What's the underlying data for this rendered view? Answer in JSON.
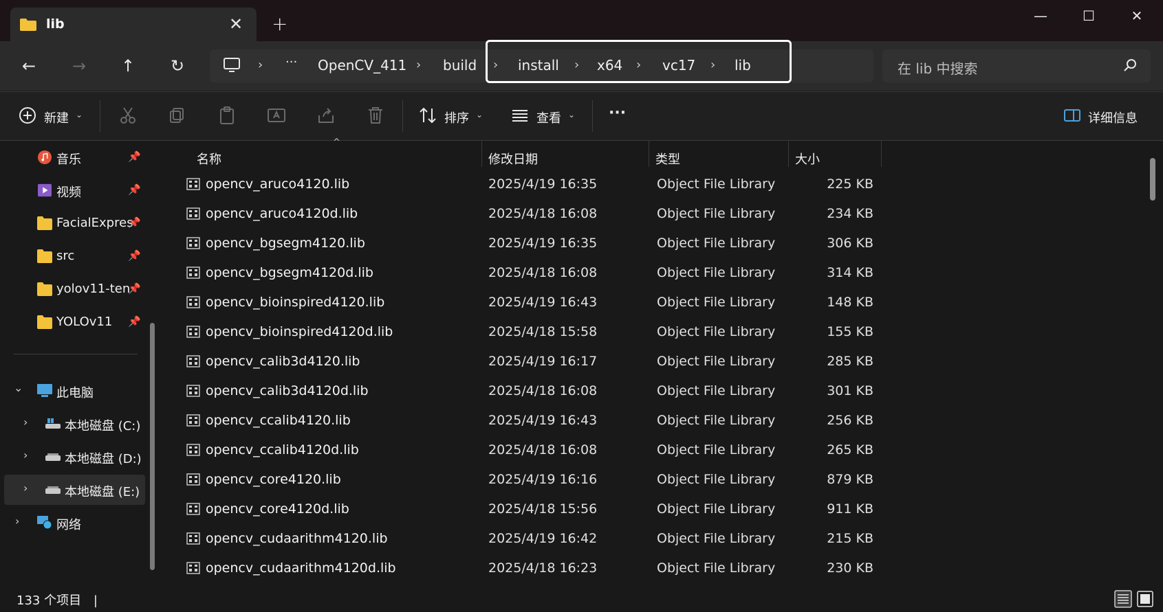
{
  "window": {
    "tab_label": "lib",
    "new_tab_symbol": "+",
    "close_tab_symbol": "✕",
    "minimize_symbol": "—",
    "maximize_symbol": "☐",
    "close_symbol": "✕"
  },
  "nav": {
    "back_symbol": "←",
    "forward_symbol": "→",
    "up_symbol": "↑",
    "refresh_symbol": "↻",
    "more_symbol": "···",
    "breadcrumb": [
      "OpenCV_411",
      "build",
      "install",
      "x64",
      "vc17",
      "lib"
    ],
    "separator": "›",
    "search_placeholder": "在 lib 中搜索"
  },
  "toolbar": {
    "new_label": "新建",
    "sort_label": "排序",
    "view_label": "查看",
    "more_label": "···",
    "details_label": "详细信息"
  },
  "sidebar": {
    "quick_access": [
      {
        "label": "音乐",
        "icon": "music-icon"
      },
      {
        "label": "视频",
        "icon": "video-icon"
      },
      {
        "label": "FacialExpres",
        "icon": "folder-icon"
      },
      {
        "label": "src",
        "icon": "folder-icon"
      },
      {
        "label": "yolov11-ten",
        "icon": "folder-icon"
      },
      {
        "label": "YOLOv11",
        "icon": "folder-icon"
      }
    ],
    "pin_symbol": "📌",
    "this_pc": "此电脑",
    "drives": [
      "本地磁盘 (C:)",
      "本地磁盘 (D:)",
      "本地磁盘 (E:)"
    ],
    "network": "网络"
  },
  "columns": {
    "name": "名称",
    "date": "修改日期",
    "type": "类型",
    "size": "大小"
  },
  "files": [
    {
      "name": "opencv_aruco4120.lib",
      "date": "2025/4/19 16:35",
      "type": "Object File Library",
      "size": "225 KB"
    },
    {
      "name": "opencv_aruco4120d.lib",
      "date": "2025/4/18 16:08",
      "type": "Object File Library",
      "size": "234 KB"
    },
    {
      "name": "opencv_bgsegm4120.lib",
      "date": "2025/4/19 16:35",
      "type": "Object File Library",
      "size": "306 KB"
    },
    {
      "name": "opencv_bgsegm4120d.lib",
      "date": "2025/4/18 16:08",
      "type": "Object File Library",
      "size": "314 KB"
    },
    {
      "name": "opencv_bioinspired4120.lib",
      "date": "2025/4/19 16:43",
      "type": "Object File Library",
      "size": "148 KB"
    },
    {
      "name": "opencv_bioinspired4120d.lib",
      "date": "2025/4/18 15:58",
      "type": "Object File Library",
      "size": "155 KB"
    },
    {
      "name": "opencv_calib3d4120.lib",
      "date": "2025/4/19 16:17",
      "type": "Object File Library",
      "size": "285 KB"
    },
    {
      "name": "opencv_calib3d4120d.lib",
      "date": "2025/4/18 16:08",
      "type": "Object File Library",
      "size": "301 KB"
    },
    {
      "name": "opencv_ccalib4120.lib",
      "date": "2025/4/19 16:43",
      "type": "Object File Library",
      "size": "256 KB"
    },
    {
      "name": "opencv_ccalib4120d.lib",
      "date": "2025/4/18 16:08",
      "type": "Object File Library",
      "size": "265 KB"
    },
    {
      "name": "opencv_core4120.lib",
      "date": "2025/4/19 16:16",
      "type": "Object File Library",
      "size": "879 KB"
    },
    {
      "name": "opencv_core4120d.lib",
      "date": "2025/4/18 15:56",
      "type": "Object File Library",
      "size": "911 KB"
    },
    {
      "name": "opencv_cudaarithm4120.lib",
      "date": "2025/4/19 16:42",
      "type": "Object File Library",
      "size": "215 KB"
    },
    {
      "name": "opencv_cudaarithm4120d.lib",
      "date": "2025/4/18 16:23",
      "type": "Object File Library",
      "size": "230 KB"
    }
  ],
  "status": {
    "item_count": "133 个项目",
    "cursor": "|"
  },
  "colors": {
    "folder": "#f3c13a",
    "accent_blue": "#4aa3df"
  }
}
